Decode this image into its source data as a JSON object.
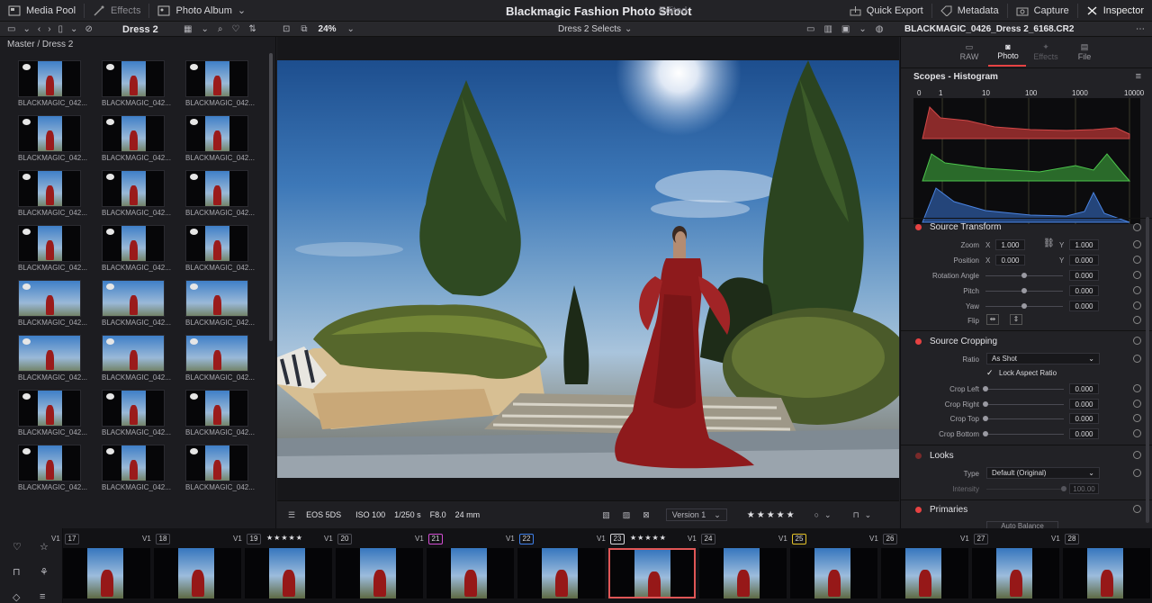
{
  "topbar": {
    "media_pool": "Media Pool",
    "effects": "Effects",
    "photo_album": "Photo Album",
    "title": "Blackmagic Fashion Photo Shoot",
    "edited": "Edited",
    "quick_export": "Quick Export",
    "metadata": "Metadata",
    "capture": "Capture",
    "inspector": "Inspector"
  },
  "toolbar": {
    "album_name": "Dress 2",
    "zoom": "24%",
    "selects": "Dress 2 Selects",
    "filename": "BLACKMAGIC_0426_Dress 2_6168.CR2"
  },
  "left_panel": {
    "breadcrumb": "Master / Dress 2",
    "thumb_label": "BLACKMAGIC_042...",
    "rows": 9,
    "cols": 3
  },
  "viewer": {
    "camera": "EOS 5DS",
    "iso": "ISO 100",
    "shutter": "1/250 s",
    "aperture": "F8.0",
    "focal": "24 mm",
    "version": "Version 1",
    "stars": "★★★★★"
  },
  "inspector": {
    "tabs": [
      "RAW",
      "Photo",
      "Effects",
      "File"
    ],
    "active_tab": "Photo",
    "scopes_title": "Scopes - Histogram",
    "hist_ticks": [
      "0",
      "1",
      "10",
      "100",
      "1000",
      "10000"
    ],
    "source_transform": {
      "title": "Source Transform",
      "zoom_label": "Zoom",
      "zoom_x": "1.000",
      "zoom_y": "1.000",
      "position_label": "Position",
      "pos_x": "0.000",
      "pos_y": "0.000",
      "rotation_label": "Rotation Angle",
      "rotation": "0.000",
      "pitch_label": "Pitch",
      "pitch": "0.000",
      "yaw_label": "Yaw",
      "yaw": "0.000",
      "flip_label": "Flip",
      "x_label": "X",
      "y_label": "Y"
    },
    "source_cropping": {
      "title": "Source Cropping",
      "ratio_label": "Ratio",
      "ratio": "As Shot",
      "lock_aspect": "Lock Aspect Ratio",
      "crop_left_label": "Crop Left",
      "crop_left": "0.000",
      "crop_right_label": "Crop Right",
      "crop_right": "0.000",
      "crop_top_label": "Crop Top",
      "crop_top": "0.000",
      "crop_bottom_label": "Crop Bottom",
      "crop_bottom": "0.000"
    },
    "looks": {
      "title": "Looks",
      "type_label": "Type",
      "type": "Default (Original)",
      "intensity_label": "Intensity",
      "intensity": "100.00"
    },
    "primaries": {
      "title": "Primaries",
      "auto_balance": "Auto Balance"
    }
  },
  "filmstrip": {
    "clips": [
      {
        "num": "17",
        "v": "V1",
        "stars": ""
      },
      {
        "num": "18",
        "v": "V1",
        "stars": ""
      },
      {
        "num": "19",
        "v": "V1",
        "stars": "★★★★★"
      },
      {
        "num": "20",
        "v": "V1",
        "stars": ""
      },
      {
        "num": "21",
        "v": "V1",
        "stars": ""
      },
      {
        "num": "22",
        "v": "V1",
        "stars": ""
      },
      {
        "num": "23",
        "v": "V1",
        "stars": "★★★★★"
      },
      {
        "num": "24",
        "v": "V1",
        "stars": ""
      },
      {
        "num": "25",
        "v": "V1",
        "stars": ""
      },
      {
        "num": "26",
        "v": "V1",
        "stars": ""
      },
      {
        "num": "27",
        "v": "V1",
        "stars": ""
      },
      {
        "num": "28",
        "v": "V1",
        "stars": ""
      }
    ],
    "selected": "23",
    "num_colors": {
      "21": "#d24dd2",
      "22": "#3f7fe8",
      "25": "#e3c22a",
      "23": "#d8d8dc"
    }
  },
  "colors": {
    "accent_red": "#e64242",
    "selected_border": "#e05656"
  }
}
